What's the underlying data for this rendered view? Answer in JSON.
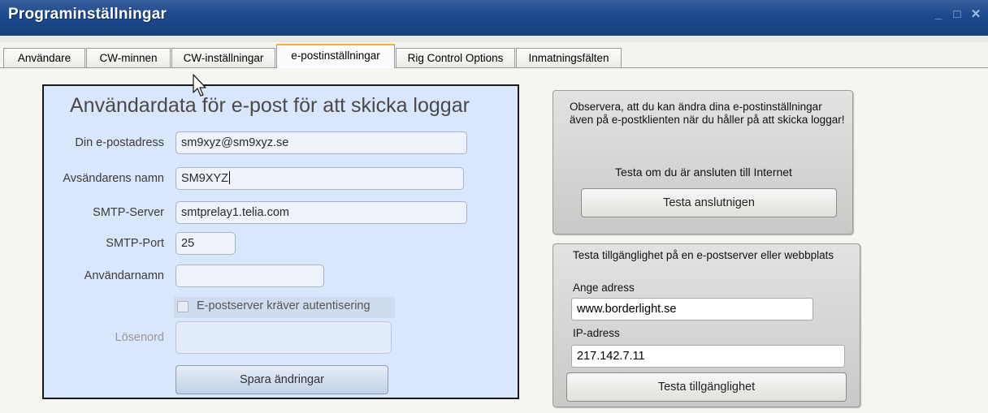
{
  "window": {
    "title": "Programinställningar",
    "controls": {
      "minimize": "_",
      "maximize": "□",
      "close": "✕"
    }
  },
  "tabs": [
    {
      "label": "Användare"
    },
    {
      "label": "CW-minnen"
    },
    {
      "label": "CW-inställningar"
    },
    {
      "label": "e-postinställningar",
      "active": true
    },
    {
      "label": "Rig Control Options"
    },
    {
      "label": "Inmatningsfälten"
    }
  ],
  "email": {
    "heading": "Användardata för e-post för att skicka loggar",
    "address_label": "Din e-postadress",
    "address_value": "sm9xyz@sm9xyz.se",
    "sender_label": "Avsändarens namn",
    "sender_value": "SM9XYZ",
    "smtp_server_label": "SMTP-Server",
    "smtp_server_value": "smtprelay1.telia.com",
    "smtp_port_label": "SMTP-Port",
    "smtp_port_value": "25",
    "username_label": "Användarnamn",
    "username_value": "",
    "auth_checkbox_label": "E-postserver kräver autentisering",
    "auth_checked": false,
    "password_label": "Lösenord",
    "password_value": "",
    "save_button": "Spara ändringar"
  },
  "connection": {
    "note": "Observera, att du kan ändra dina e-postinställningar även på e-postklienten när du håller på att skicka loggar!",
    "test_text": "Testa om du är ansluten till Internet",
    "test_button": "Testa anslutnigen"
  },
  "availability": {
    "title": "Testa tillgänglighet på en e-postserver eller webbplats",
    "address_label": "Ange adress",
    "address_value": "www.borderlight.se",
    "ip_label": "IP-adress",
    "ip_value": "217.142.7.11",
    "test_button": "Testa tillgänglighet"
  },
  "icons": {
    "cursor": "mouse-pointer-icon"
  },
  "colors": {
    "titlebar": "#1e4a8e",
    "active_tab_accent": "#f3b03c",
    "form_panel": "#d8e7fb"
  }
}
